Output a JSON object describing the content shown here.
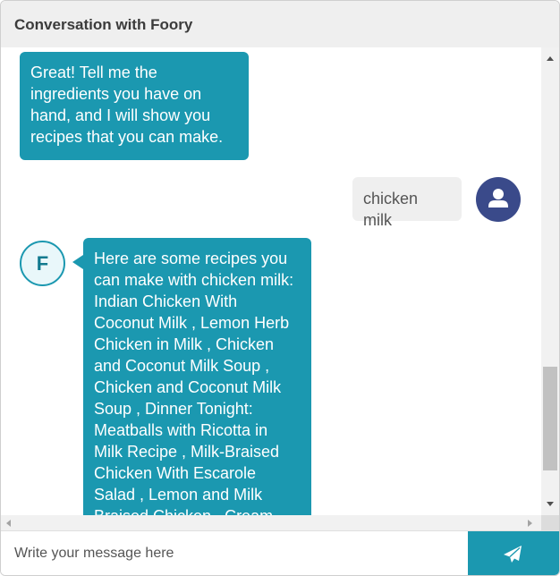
{
  "header": {
    "title": "Conversation with Foory"
  },
  "messages": [
    {
      "sender": "bot",
      "text": "Great! Tell me the ingredients you have on hand, and I will show you recipes that you can make."
    },
    {
      "sender": "user",
      "text": "chicken milk"
    },
    {
      "sender": "bot",
      "avatar_letter": "F",
      "text": "Here are some recipes you can make with chicken milk: Indian Chicken With Coconut Milk , Lemon Herb Chicken in Milk , Chicken and Coconut Milk Soup , Chicken and Coconut Milk Soup , Dinner Tonight: Meatballs with Ricotta in Milk Recipe , Milk-Braised Chicken With Escarole Salad , Lemon and Milk Braised Chicken , Cream and Chicken"
    }
  ],
  "input": {
    "placeholder": "Write your message here",
    "value": ""
  },
  "icons": {
    "user_avatar": "user-icon",
    "send": "paper-plane-icon",
    "scroll_up": "arrow-up-icon",
    "scroll_down": "arrow-down-icon",
    "scroll_left": "arrow-left-icon",
    "scroll_right": "arrow-right-icon"
  },
  "colors": {
    "accent": "#1b98b0",
    "user_avatar_bg": "#3a4a8a",
    "header_bg": "#efefef",
    "user_bubble_bg": "#efefef"
  }
}
